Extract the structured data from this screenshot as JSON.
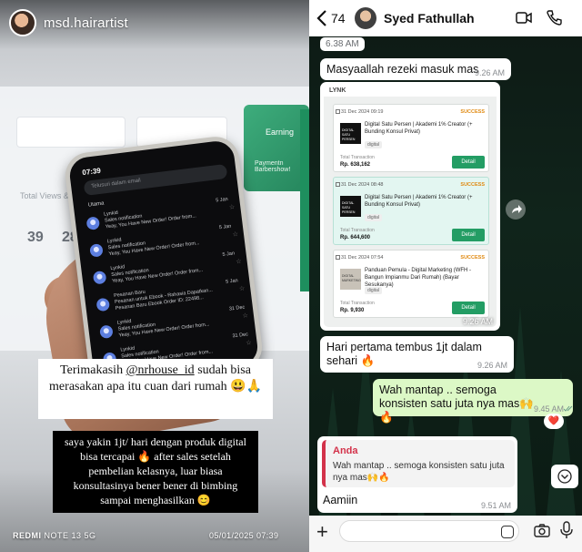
{
  "story": {
    "username": "msd.hairartist",
    "phone_screen": {
      "time": "07:39",
      "search_placeholder": "Telusuri dalam email",
      "section": "Utama",
      "items": [
        {
          "sender": "Lynkid",
          "line1": "Sales notification",
          "line2": "Yeay, You Have New Order! Order from...",
          "date": "5 Jan"
        },
        {
          "sender": "Lynkid",
          "line1": "Sales notification",
          "line2": "Yeay, You Have New Order! Order from...",
          "date": "5 Jan"
        },
        {
          "sender": "Lynkid",
          "line1": "Sales notification",
          "line2": "Yeay, You Have New Order! Order from...",
          "date": "5 Jan"
        },
        {
          "sender": "Pesanan Baru",
          "line1": "Pesanan untuk Ebook - Rahasia Dapatkan...",
          "line2": "Pesanan Baru Ebook Order ID: 22498...",
          "date": "5 Jan"
        },
        {
          "sender": "Lynkid",
          "line1": "Sales notification",
          "line2": "Yeay, You Have New Order! Order from...",
          "date": "31 Dec"
        },
        {
          "sender": "Lynkid",
          "line1": "Sales notification",
          "line2": "Yeay, You Have New Order! Order from...",
          "date": "31 Dec"
        }
      ]
    },
    "monitor": {
      "label1": "Total Views & Clicks",
      "num1": "39",
      "num2": "28",
      "label2": "Earning",
      "label3": "Paymentn Barbershow!"
    },
    "caption1_pre": "Terimakasih ",
    "caption1_handle": "@nrhouse_id",
    "caption1_post": " sudah bisa merasakan apa itu cuan dari rumah 😃🙏",
    "caption2": "saya yakin 1jt/ hari dengan produk digital bisa tercapai 🔥 after sales setelah pembelian kelasnya, luar biasa konsultasinya bener bener di bimbing sampai menghasilkan 😊",
    "device_brand": "REDMI",
    "device_model": " NOTE 13 5G",
    "date": "05/01/2025  07:39"
  },
  "chat": {
    "back_count": "74",
    "contact_name": "Syed Fathullah",
    "accent_color": "#25d366",
    "messages": [
      {
        "id": "m0",
        "text": "6.38 AM",
        "direction": "in"
      },
      {
        "id": "m1",
        "text": "Masyaallah rezeki masuk mas",
        "time": "9.26 AM",
        "direction": "in"
      },
      {
        "id": "m2",
        "type": "image",
        "time": "9.26 AM",
        "direction": "in"
      },
      {
        "id": "m3",
        "text": "Hari pertama tembus 1jt dalam sehari 🔥",
        "time": "9.26 AM",
        "direction": "in"
      },
      {
        "id": "m4",
        "text": "Wah mantap .. semoga konsisten satu juta nya mas🙌🔥",
        "time": "9.45 AM",
        "direction": "out",
        "reaction": "❤️"
      },
      {
        "id": "m5",
        "reply_to_name": "Anda",
        "reply_to_text": "Wah mantap .. semoga konsisten satu juta nya mas🙌🔥",
        "text": "Aamiin",
        "time": "9.51 AM",
        "direction": "in"
      }
    ],
    "transactions_header": "LYNK",
    "transactions": [
      {
        "date": "31 Dec 2024 09:19",
        "status": "SUCCESS",
        "thumb": "DIGITAL SATU PERSEN",
        "title": "Digital Satu Persen | Akademi 1% Creator (+ Bunding Konsul Privat)",
        "tag": "digital",
        "total_label": "Total Transaction",
        "amount": "Rp. 638,162",
        "button": "Detail",
        "highlight": false
      },
      {
        "date": "31 Dec 2024 08:48",
        "status": "SUCCESS",
        "thumb": "DIGITAL SATU PERSEN",
        "title": "Digital Satu Persen | Akademi 1% Creator (+ Bunding Konsul Privat)",
        "tag": "digital",
        "total_label": "Total Transaction",
        "amount": "Rp. 644,600",
        "button": "Detail",
        "highlight": true
      },
      {
        "date": "31 Dec 2024 07:54",
        "status": "SUCCESS",
        "thumb": "DIGITAL MARKETING",
        "title": "Panduan Pemula - Digital Marketing (WFH - Bangun Impianmu Dari Rumah) (Bayar Sesukanya)",
        "tag": "digital",
        "total_label": "Total Transaction",
        "amount": "Rp. 9,930",
        "button": "Detail",
        "highlight": false
      }
    ]
  }
}
